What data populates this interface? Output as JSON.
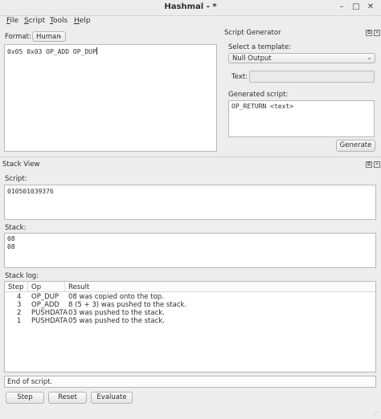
{
  "window": {
    "title": "Hashmal - *"
  },
  "menu": [
    {
      "label": "File",
      "key": "F",
      "rest": "ile"
    },
    {
      "label": "Script",
      "key": "S",
      "rest": "cript"
    },
    {
      "label": "Tools",
      "key": "T",
      "rest": "ools"
    },
    {
      "label": "Help",
      "key": "H",
      "rest": "elp"
    }
  ],
  "editor": {
    "format_label": "Format:",
    "format_value": "Human",
    "script_text": "0x05 0x03 OP_ADD OP_DUP"
  },
  "script_generator": {
    "title": "Script Generator",
    "template_label": "Select a template:",
    "template_value": "Null Output",
    "text_label": "Text:",
    "text_value": "",
    "generated_label": "Generated script:",
    "generated_value": "OP_RETURN <text>",
    "generate_button": "Generate"
  },
  "stack_view": {
    "title": "Stack View",
    "script_label": "Script:",
    "script_value": "010501039376",
    "stack_label": "Stack:",
    "stack_items": [
      "08",
      "08"
    ],
    "log_label": "Stack log:",
    "log_headers": [
      "Step",
      "Op",
      "Result"
    ],
    "log_rows": [
      {
        "step": "4",
        "op": "OP_DUP",
        "result": "08 was copied onto the top."
      },
      {
        "step": "3",
        "op": "OP_ADD",
        "result": "8 (5 + 3) was pushed to the stack."
      },
      {
        "step": "2",
        "op": "PUSHDATA",
        "result": "03 was pushed to the stack."
      },
      {
        "step": "1",
        "op": "PUSHDATA",
        "result": "05 was pushed to the stack."
      }
    ],
    "status": "End of script.",
    "step_button": "Step",
    "reset_button": "Reset",
    "evaluate_button": "Evaluate"
  }
}
